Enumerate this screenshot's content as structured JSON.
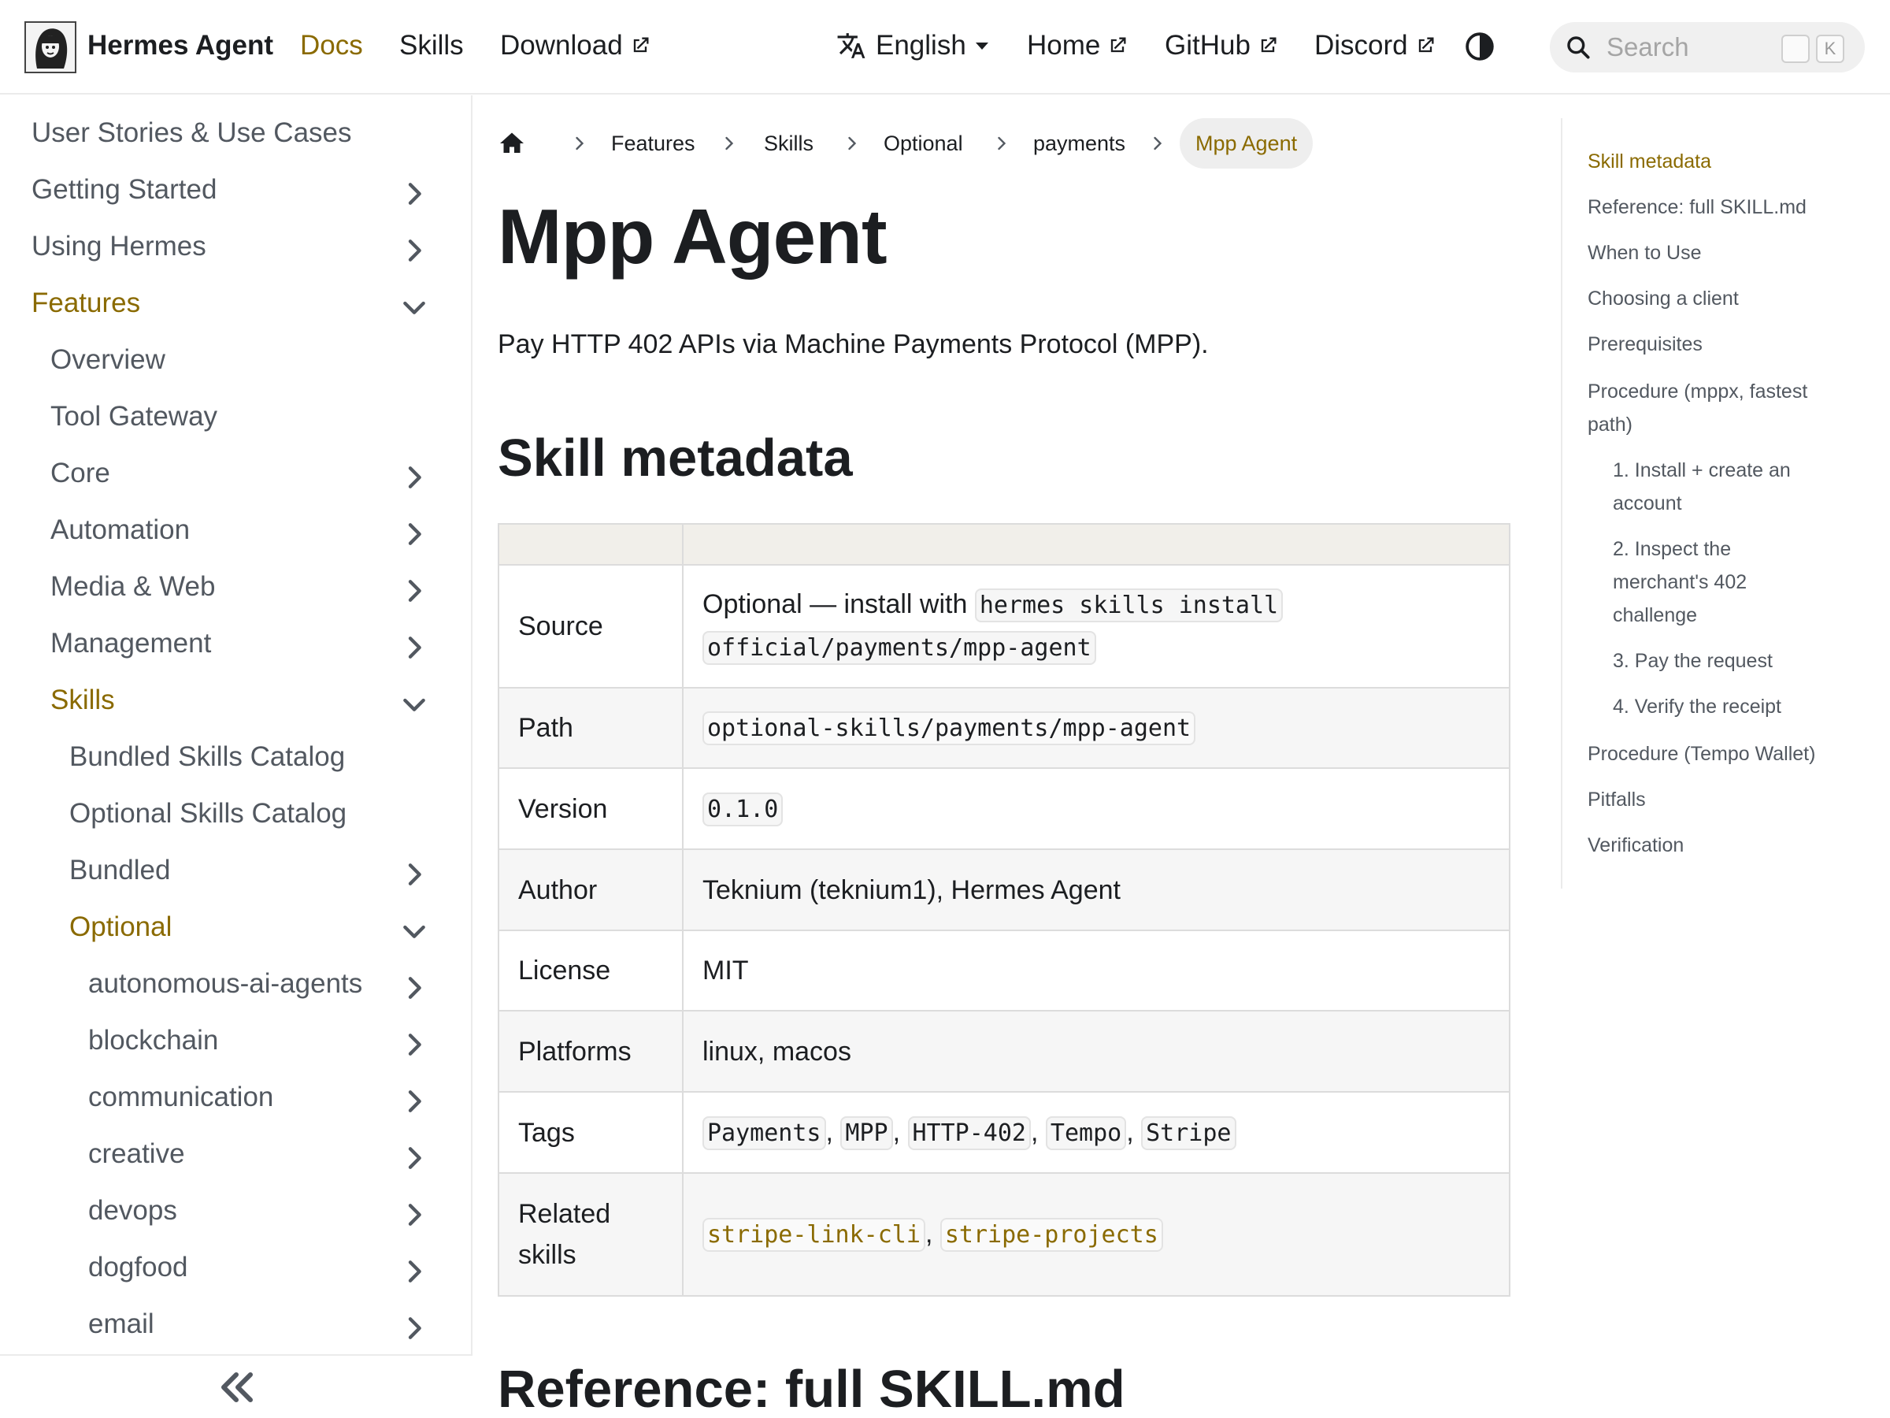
{
  "navbar": {
    "brand": "Hermes Agent",
    "links": {
      "docs": "Docs",
      "skills": "Skills",
      "download": "Download",
      "language": "English",
      "home": "Home",
      "github": "GitHub",
      "discord": "Discord"
    },
    "search_placeholder": "Search",
    "search_shortcut": [
      "",
      "K"
    ]
  },
  "sidebar": {
    "items": [
      {
        "label": "User Stories & Use Cases"
      },
      {
        "label": "Getting Started"
      },
      {
        "label": "Using Hermes"
      },
      {
        "label": "Features"
      },
      {
        "label": "Overview"
      },
      {
        "label": "Tool Gateway"
      },
      {
        "label": "Core"
      },
      {
        "label": "Automation"
      },
      {
        "label": "Media & Web"
      },
      {
        "label": "Management"
      },
      {
        "label": "Skills"
      },
      {
        "label": "Bundled Skills Catalog"
      },
      {
        "label": "Optional Skills Catalog"
      },
      {
        "label": "Bundled"
      },
      {
        "label": "Optional"
      },
      {
        "label": "autonomous-ai-agents"
      },
      {
        "label": "blockchain"
      },
      {
        "label": "communication"
      },
      {
        "label": "creative"
      },
      {
        "label": "devops"
      },
      {
        "label": "dogfood"
      },
      {
        "label": "email"
      }
    ]
  },
  "breadcrumb": {
    "items": [
      "Features",
      "Skills",
      "Optional",
      "payments"
    ],
    "current": "Mpp Agent"
  },
  "page": {
    "title": "Mpp Agent",
    "description": "Pay HTTP 402 APIs via Machine Payments Protocol (MPP).",
    "section_metadata": "Skill metadata",
    "section_reference": "Reference: full SKILL.md"
  },
  "metadata": {
    "source_key": "Source",
    "source_text": "Optional — install with",
    "source_code_1": "hermes skills install",
    "source_code_2": "official/payments/mpp-agent",
    "path_key": "Path",
    "path_code": "optional-skills/payments/mpp-agent",
    "version_key": "Version",
    "version_code": "0.1.0",
    "author_key": "Author",
    "author_value": "Teknium (teknium1), Hermes Agent",
    "license_key": "License",
    "license_value": "MIT",
    "platforms_key": "Platforms",
    "platforms_value": "linux, macos",
    "tags_key": "Tags",
    "tags": [
      "Payments",
      "MPP",
      "HTTP-402",
      "Tempo",
      "Stripe"
    ],
    "related_key_1": "Related",
    "related_key_2": "skills",
    "related": [
      "stripe-link-cli",
      "stripe-projects"
    ]
  },
  "toc": {
    "items": [
      "Skill metadata",
      "Reference: full SKILL.md",
      "When to Use",
      "Choosing a client",
      "Prerequisites",
      "Procedure (mppx, fastest path)",
      "1. Install + create an account",
      "2. Inspect the merchant's 402 challenge",
      "3. Pay the request",
      "4. Verify the receipt",
      "Procedure (Tempo Wallet)",
      "Pitfalls",
      "Verification"
    ]
  },
  "colors": {
    "accent": "#8a6a00",
    "text": "#1c1e21",
    "muted": "#525860",
    "border": "#ebebeb",
    "table_header": "#f1efea"
  }
}
